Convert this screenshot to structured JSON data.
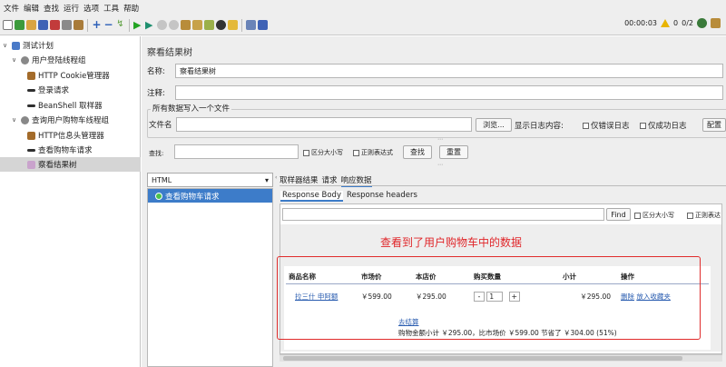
{
  "menu": [
    "文件",
    "编辑",
    "查找",
    "运行",
    "选项",
    "工具",
    "帮助"
  ],
  "status": {
    "elapsed": "00:00:03",
    "warnings": "0",
    "threads": "0/2"
  },
  "tree": {
    "root": "测试计划",
    "group1": "用户登陆线程组",
    "cookie": "HTTP Cookie管理器",
    "login": "登录请求",
    "beanshell": "BeanShell 取样器",
    "group2": "查询用户购物车线程组",
    "header": "HTTP信息头管理器",
    "cartreq": "查看购物车请求",
    "result": "察看结果树"
  },
  "panel": {
    "title": "察看结果树",
    "name_label": "名称:",
    "name_value": "察看结果树",
    "comment_label": "注释:",
    "comment_value": "",
    "file_section": "所有数据写入一个文件",
    "filename_label": "文件名",
    "browse": "浏览...",
    "log_label": "显示日志内容:",
    "errors_only": "仅错误日志",
    "success_only": "仅成功日志",
    "config": "配置",
    "search_label": "查找:",
    "case_sensitive": "区分大小写",
    "regex": "正则表达式",
    "find_btn": "查找",
    "reset_btn": "重置"
  },
  "results": {
    "renderer": "HTML",
    "items": [
      "查看购物车请求"
    ],
    "tabs": [
      "取样器结果",
      "请求",
      "响应数据"
    ],
    "subtabs": [
      "Response Body",
      "Response headers"
    ],
    "find_btn": "Find",
    "case_sensitive": "区分大小写",
    "regex": "正则表达"
  },
  "annotation": "查看到了用户购物车中的数据",
  "cart": {
    "headers": [
      "商品名称",
      "市场价",
      "本店价",
      "购买数量",
      "小计",
      "操作"
    ],
    "row": {
      "name": "拉三什 申阿额",
      "market": "￥599.00",
      "shop": "￥295.00",
      "qty": "1",
      "minus": "-",
      "plus": "+",
      "subtotal": "￥295.00",
      "del": "删除",
      "fav": "放入收藏夹"
    },
    "checkout": "去结算",
    "summary": "购物金额小计 ￥295.00，比市场价 ￥599.00 节省了 ￥304.00 (51%)"
  },
  "colors": {
    "accent": "#3d7cc9",
    "annotation": "#e0262a",
    "box": "#e02c2c"
  }
}
